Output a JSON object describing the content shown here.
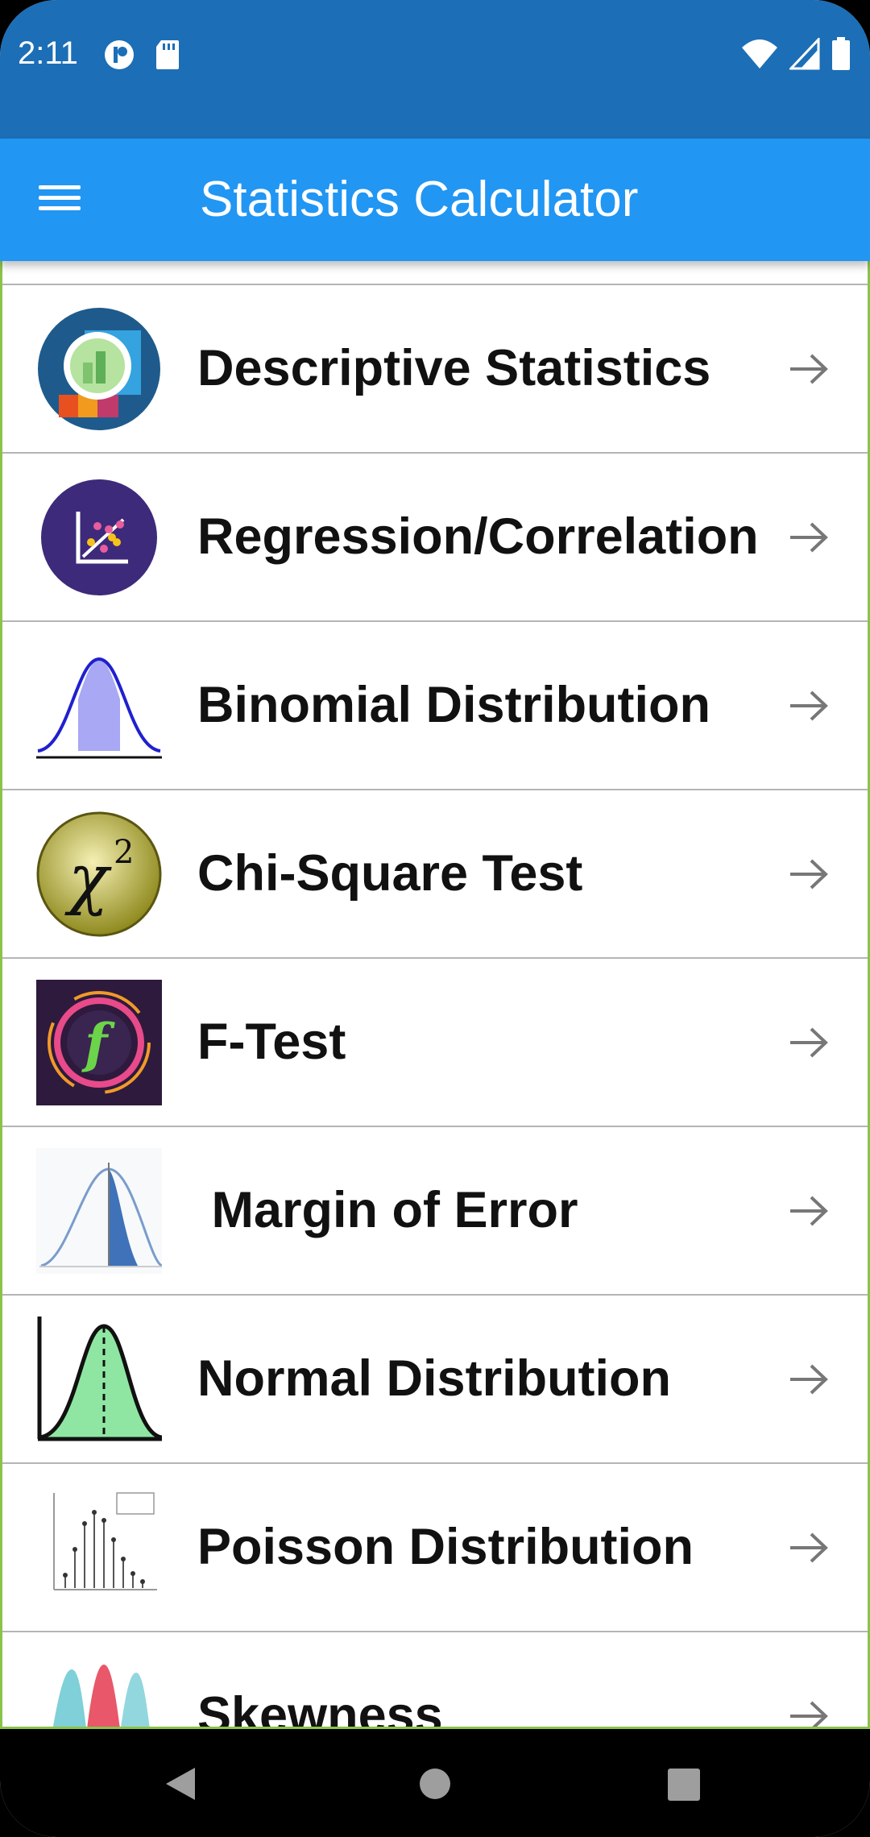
{
  "status_bar": {
    "time": "2:11",
    "left_icons": [
      "notification-app-icon",
      "sd-card-icon"
    ],
    "right_icons": [
      "wifi-icon",
      "cell-signal-icon",
      "battery-icon"
    ]
  },
  "app_bar": {
    "title": "Statistics Calculator",
    "menu_icon": "hamburger-menu-icon",
    "background": "#2196f3",
    "status_background": "#1c6eb6"
  },
  "list": {
    "items": [
      {
        "label": "Descriptive Statistics",
        "icon": "descriptive-statistics-icon"
      },
      {
        "label": "Regression/Correlation",
        "icon": "regression-correlation-icon"
      },
      {
        "label": "Binomial Distribution",
        "icon": "binomial-distribution-icon"
      },
      {
        "label": "Chi-Square Test",
        "icon": "chi-square-icon"
      },
      {
        "label": "F-Test",
        "icon": "f-test-icon"
      },
      {
        "label": " Margin of Error",
        "icon": "margin-of-error-icon"
      },
      {
        "label": "Normal Distribution",
        "icon": "normal-distribution-icon"
      },
      {
        "label": "Poisson Distribution",
        "icon": "poisson-distribution-icon"
      },
      {
        "label": "Skewness",
        "icon": "skewness-icon"
      }
    ],
    "arrow_icon": "arrow-right-icon",
    "border_accent": "#8bc34a"
  },
  "nav_bar": {
    "buttons": [
      "back-icon",
      "home-icon",
      "recents-icon"
    ]
  }
}
